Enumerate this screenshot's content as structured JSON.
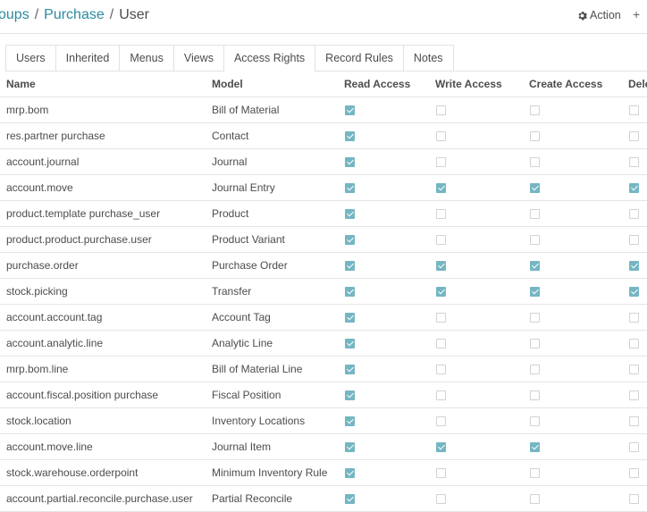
{
  "breadcrumb": {
    "parent": "oups",
    "items": [
      "Purchase",
      "User"
    ],
    "separator": "/"
  },
  "actions": {
    "action_label": "Action",
    "more_label": "+"
  },
  "tabs": [
    {
      "label": "Users",
      "active": false
    },
    {
      "label": "Inherited",
      "active": false
    },
    {
      "label": "Menus",
      "active": false
    },
    {
      "label": "Views",
      "active": false
    },
    {
      "label": "Access Rights",
      "active": true
    },
    {
      "label": "Record Rules",
      "active": false
    },
    {
      "label": "Notes",
      "active": false
    }
  ],
  "columns": [
    "Name",
    "Model",
    "Read Access",
    "Write Access",
    "Create Access",
    "Dele"
  ],
  "rows": [
    {
      "name": "mrp.bom",
      "model": "Bill of Material",
      "read": true,
      "write": false,
      "create": false,
      "delete": false
    },
    {
      "name": "res.partner purchase",
      "model": "Contact",
      "read": true,
      "write": false,
      "create": false,
      "delete": false
    },
    {
      "name": "account.journal",
      "model": "Journal",
      "read": true,
      "write": false,
      "create": false,
      "delete": false
    },
    {
      "name": "account.move",
      "model": "Journal Entry",
      "read": true,
      "write": true,
      "create": true,
      "delete": true
    },
    {
      "name": "product.template purchase_user",
      "model": "Product",
      "read": true,
      "write": false,
      "create": false,
      "delete": false
    },
    {
      "name": "product.product.purchase.user",
      "model": "Product Variant",
      "read": true,
      "write": false,
      "create": false,
      "delete": false
    },
    {
      "name": "purchase.order",
      "model": "Purchase Order",
      "read": true,
      "write": true,
      "create": true,
      "delete": true
    },
    {
      "name": "stock.picking",
      "model": "Transfer",
      "read": true,
      "write": true,
      "create": true,
      "delete": true
    },
    {
      "name": "account.account.tag",
      "model": "Account Tag",
      "read": true,
      "write": false,
      "create": false,
      "delete": false
    },
    {
      "name": "account.analytic.line",
      "model": "Analytic Line",
      "read": true,
      "write": false,
      "create": false,
      "delete": false
    },
    {
      "name": "mrp.bom.line",
      "model": "Bill of Material Line",
      "read": true,
      "write": false,
      "create": false,
      "delete": false
    },
    {
      "name": "account.fiscal.position purchase",
      "model": "Fiscal Position",
      "read": true,
      "write": false,
      "create": false,
      "delete": false
    },
    {
      "name": "stock.location",
      "model": "Inventory Locations",
      "read": true,
      "write": false,
      "create": false,
      "delete": false
    },
    {
      "name": "account.move.line",
      "model": "Journal Item",
      "read": true,
      "write": true,
      "create": true,
      "delete": false
    },
    {
      "name": "stock.warehouse.orderpoint",
      "model": "Minimum Inventory Rule",
      "read": true,
      "write": false,
      "create": false,
      "delete": false
    },
    {
      "name": "account.partial.reconcile.purchase.user",
      "model": "Partial Reconcile",
      "read": true,
      "write": false,
      "create": false,
      "delete": false
    }
  ],
  "colors": {
    "accent": "#2b8aa0",
    "checkbox_checked": "#75b6c3",
    "border": "#e4e4e4"
  }
}
